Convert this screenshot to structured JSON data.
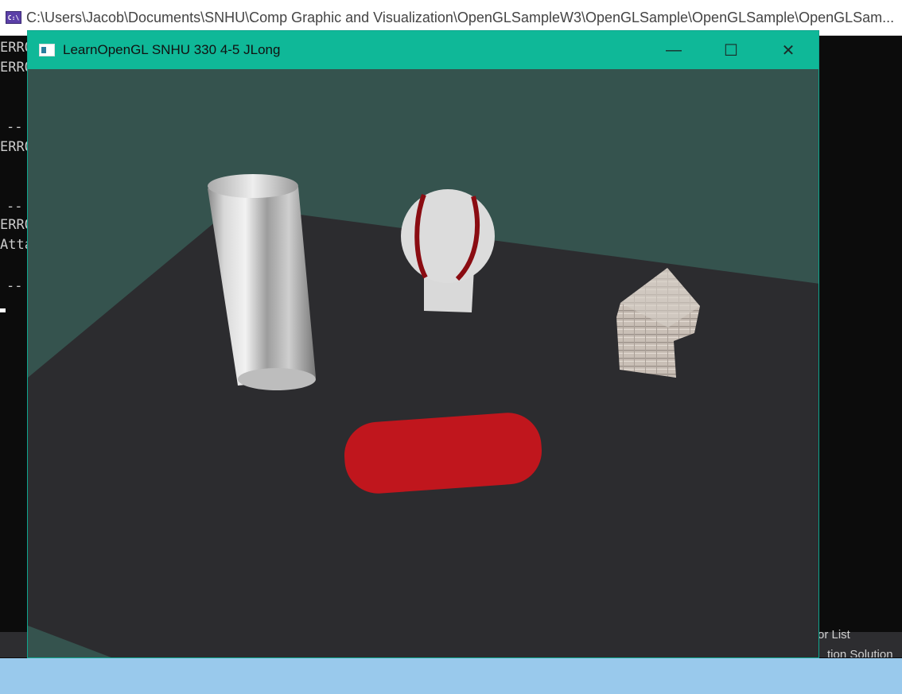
{
  "console": {
    "icon_label": "C:\\",
    "title_path": "C:\\Users\\Jacob\\Documents\\SNHU\\Comp Graphic and Visualization\\OpenGLSampleW3\\OpenGLSample\\OpenGLSample\\OpenGLSam...",
    "lines": [
      "ERRO",
      "ERRO",
      "--",
      "ERRO",
      "--",
      "ERRO",
      "Atta",
      "--"
    ]
  },
  "gl_window": {
    "title": "LearnOpenGL SNHU 330 4-5 JLong",
    "minimize_glyph": "—",
    "maximize_glyph": "☐",
    "close_glyph": "✕"
  },
  "vs_strip": {
    "right_label_1": "or List",
    "right_label_2": "tion Solution"
  },
  "colors": {
    "gl_titlebar": "#0fb898",
    "backdrop": "#35534e",
    "plane": "#2c2c2f",
    "pill": "#c0161d",
    "ball_seam": "#8a0c12",
    "desktop_band": "#99c9ec"
  },
  "scene_objects": [
    "cylinder",
    "baseball",
    "wooden-house",
    "red-pill",
    "plane"
  ]
}
